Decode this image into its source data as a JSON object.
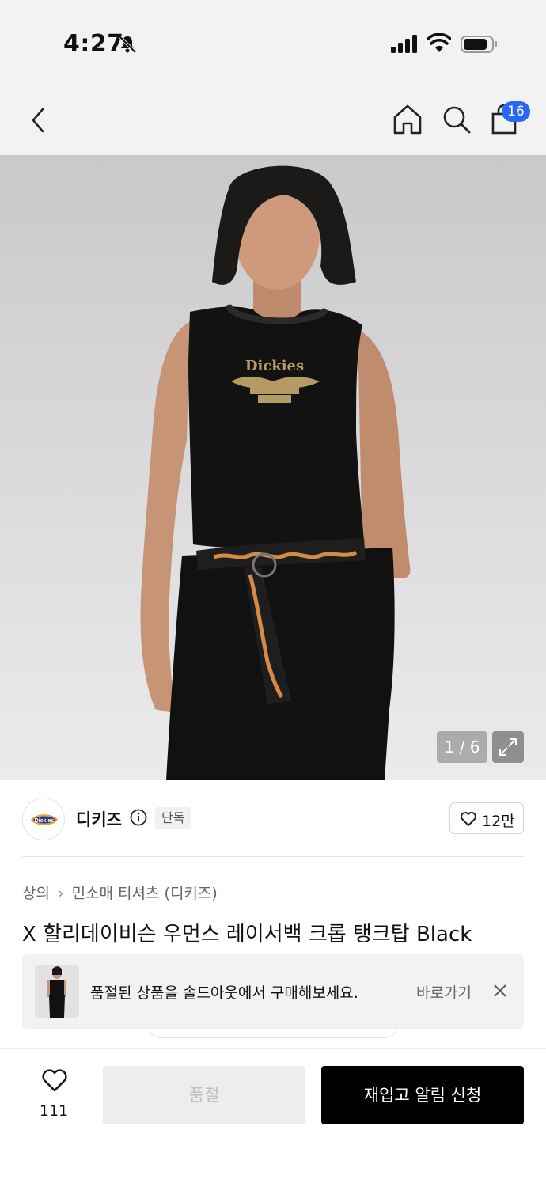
{
  "status_bar": {
    "time": "4:27"
  },
  "header": {
    "cart_count": "16"
  },
  "gallery": {
    "counter": "1 / 6"
  },
  "brand": {
    "name": "디키즈",
    "exclusive_tag": "단독",
    "likes": "12만",
    "logo_text": "Dickies"
  },
  "breadcrumb": {
    "category": "상의",
    "subcategory": "민소매 티셔츠 (디키즈)"
  },
  "product": {
    "title": "X 할리데이비슨 우먼스 레이서백 크롭 탱크탑 Black",
    "print_brand": "Dickies"
  },
  "banner": {
    "message": "품절된 상품을 솔드아웃에서 구매해보세요.",
    "link": "바로가기"
  },
  "bottom_bar": {
    "wish_count": "111",
    "soldout_label": "품절",
    "restock_label": "재입고 알림 신청"
  },
  "colors": {
    "accent": "#2a67f5",
    "primary_button": "#000000",
    "disabled_button": "#ededed"
  }
}
